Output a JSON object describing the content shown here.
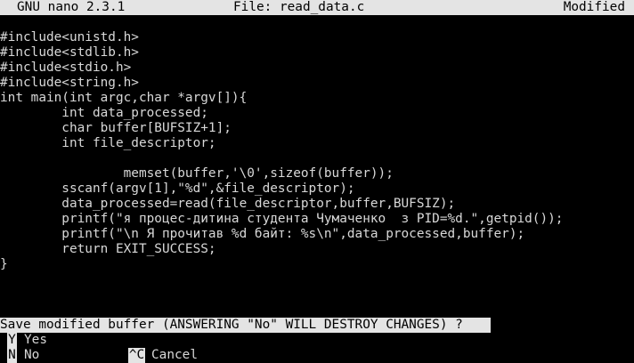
{
  "titlebar": {
    "app": "GNU nano 2.3.1",
    "file": "File: read_data.c",
    "status": "Modified"
  },
  "editor": {
    "lines": [
      "#include<unistd.h>",
      "#include<stdlib.h>",
      "#include<stdio.h>",
      "#include<string.h>",
      "int main(int argc,char *argv[]){",
      "        int data_processed;",
      "        char buffer[BUFSIZ+1];",
      "        int file_descriptor;",
      "",
      "                memset(buffer,'\\0',sizeof(buffer));",
      "        sscanf(argv[1],\"%d\",&file_descriptor);",
      "        data_processed=read(file_descriptor,buffer,BUFSIZ);",
      "        printf(\"я процес-дитина студента Чумаченко  з PID=%d.\",getpid());",
      "        printf(\"\\n Я прочитав %d байт: %s\\n\",data_processed,buffer);",
      "        return EXIT_SUCCESS;",
      "}"
    ]
  },
  "prompt": {
    "text": "Save modified buffer (ANSWERING \"No\" WILL DESTROY CHANGES) ?"
  },
  "options": {
    "yes_key": "Y",
    "yes_label": "Yes",
    "no_key": "N",
    "no_label": "No",
    "cancel_key": "^C",
    "cancel_label": "Cancel"
  },
  "colors": {
    "background": "#000000",
    "bar": "#e4e4e4",
    "text": "#d8d8d8"
  }
}
